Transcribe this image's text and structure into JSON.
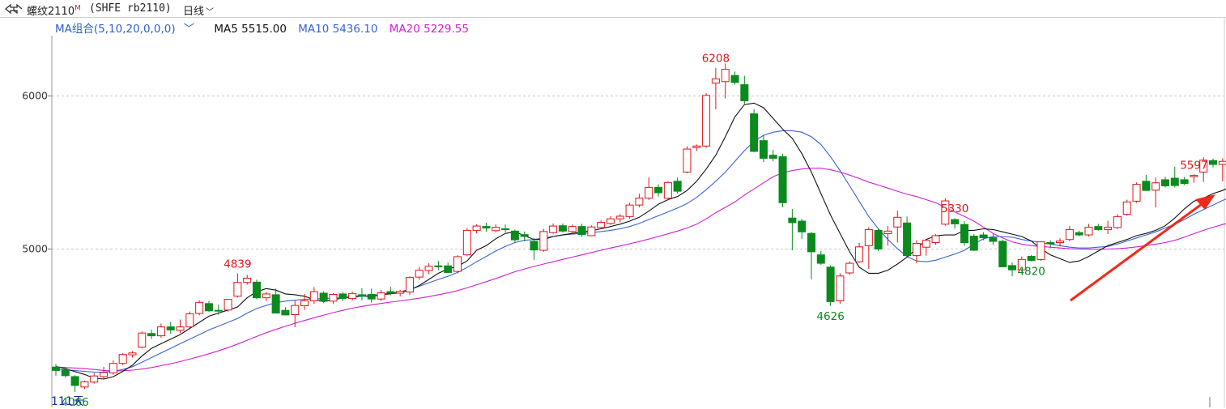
{
  "header": {
    "symbol_name": "螺纹2110",
    "symbol_flag": "M",
    "symbol_code": "(SHFE rb2110)",
    "period": "日线"
  },
  "ma_legend": {
    "combo_label": "MA组合(5,10,20,0,0,0)",
    "ma5_label": "MA5 5515.00",
    "ma10_label": "MA10 5436.10",
    "ma20_label": "MA20 5229.55"
  },
  "bottom_label": "111天",
  "colors": {
    "up": "#e0151b",
    "down": "#0b8a1e",
    "ma5": "#111111",
    "ma10": "#3a63d8",
    "ma20": "#d21ed2",
    "grid": "#c8c8c8",
    "arrow": "#ef2a1a"
  },
  "chart_data": {
    "type": "candlestick",
    "ylim": [
      3965,
      6390
    ],
    "yticks": [
      5000,
      6000
    ],
    "grid": true,
    "annotations": [
      {
        "index": 2,
        "value": 4066,
        "label": "4066",
        "position": "below",
        "color": "down"
      },
      {
        "index": 19,
        "value": 4839,
        "label": "4839",
        "position": "above",
        "color": "up"
      },
      {
        "index": 69,
        "value": 6208,
        "label": "6208",
        "position": "above",
        "color": "up"
      },
      {
        "index": 81,
        "value": 4626,
        "label": "4626",
        "position": "below",
        "color": "down"
      },
      {
        "index": 94,
        "value": 5330,
        "label": "5330",
        "position": "above",
        "color": "up"
      },
      {
        "index": 102,
        "value": 4820,
        "label": "4820",
        "position": "below",
        "color": "down"
      },
      {
        "index": 119,
        "value": 5597,
        "label": "5597",
        "position": "above",
        "color": "up"
      }
    ],
    "candles": [
      {
        "o": 4228,
        "h": 4248,
        "l": 4172,
        "c": 4206
      },
      {
        "o": 4212,
        "h": 4228,
        "l": 4160,
        "c": 4172
      },
      {
        "o": 4166,
        "h": 4175,
        "l": 4066,
        "c": 4108
      },
      {
        "o": 4098,
        "h": 4140,
        "l": 4085,
        "c": 4132
      },
      {
        "o": 4130,
        "h": 4188,
        "l": 4120,
        "c": 4170
      },
      {
        "o": 4166,
        "h": 4230,
        "l": 4150,
        "c": 4192
      },
      {
        "o": 4190,
        "h": 4272,
        "l": 4178,
        "c": 4252
      },
      {
        "o": 4252,
        "h": 4320,
        "l": 4240,
        "c": 4310
      },
      {
        "o": 4308,
        "h": 4332,
        "l": 4290,
        "c": 4320
      },
      {
        "o": 4358,
        "h": 4460,
        "l": 4350,
        "c": 4450
      },
      {
        "o": 4447,
        "h": 4472,
        "l": 4412,
        "c": 4432
      },
      {
        "o": 4432,
        "h": 4512,
        "l": 4420,
        "c": 4490
      },
      {
        "o": 4490,
        "h": 4522,
        "l": 4445,
        "c": 4470
      },
      {
        "o": 4468,
        "h": 4538,
        "l": 4450,
        "c": 4490
      },
      {
        "o": 4490,
        "h": 4590,
        "l": 4480,
        "c": 4575
      },
      {
        "o": 4578,
        "h": 4662,
        "l": 4566,
        "c": 4650
      },
      {
        "o": 4642,
        "h": 4658,
        "l": 4588,
        "c": 4595
      },
      {
        "o": 4598,
        "h": 4635,
        "l": 4570,
        "c": 4595
      },
      {
        "o": 4600,
        "h": 4662,
        "l": 4588,
        "c": 4670
      },
      {
        "o": 4690,
        "h": 4839,
        "l": 4682,
        "c": 4780
      },
      {
        "o": 4780,
        "h": 4830,
        "l": 4765,
        "c": 4808
      },
      {
        "o": 4782,
        "h": 4798,
        "l": 4670,
        "c": 4680
      },
      {
        "o": 4680,
        "h": 4718,
        "l": 4660,
        "c": 4705
      },
      {
        "o": 4700,
        "h": 4740,
        "l": 4600,
        "c": 4580
      },
      {
        "o": 4598,
        "h": 4618,
        "l": 4565,
        "c": 4568
      },
      {
        "o": 4570,
        "h": 4660,
        "l": 4488,
        "c": 4630
      },
      {
        "o": 4628,
        "h": 4705,
        "l": 4602,
        "c": 4660
      },
      {
        "o": 4660,
        "h": 4750,
        "l": 4640,
        "c": 4720
      },
      {
        "o": 4710,
        "h": 4722,
        "l": 4645,
        "c": 4658
      },
      {
        "o": 4658,
        "h": 4710,
        "l": 4640,
        "c": 4702
      },
      {
        "o": 4705,
        "h": 4718,
        "l": 4660,
        "c": 4675
      },
      {
        "o": 4675,
        "h": 4720,
        "l": 4662,
        "c": 4708
      },
      {
        "o": 4700,
        "h": 4742,
        "l": 4662,
        "c": 4690
      },
      {
        "o": 4702,
        "h": 4740,
        "l": 4648,
        "c": 4672
      },
      {
        "o": 4672,
        "h": 4732,
        "l": 4660,
        "c": 4712
      },
      {
        "o": 4720,
        "h": 4752,
        "l": 4696,
        "c": 4710
      },
      {
        "o": 4710,
        "h": 4732,
        "l": 4688,
        "c": 4722
      },
      {
        "o": 4718,
        "h": 4820,
        "l": 4700,
        "c": 4812
      },
      {
        "o": 4815,
        "h": 4882,
        "l": 4798,
        "c": 4860
      },
      {
        "o": 4858,
        "h": 4905,
        "l": 4835,
        "c": 4885
      },
      {
        "o": 4888,
        "h": 4920,
        "l": 4860,
        "c": 4882
      },
      {
        "o": 4888,
        "h": 4910,
        "l": 4842,
        "c": 4845
      },
      {
        "o": 4852,
        "h": 4958,
        "l": 4840,
        "c": 4948
      },
      {
        "o": 4960,
        "h": 5135,
        "l": 4950,
        "c": 5120
      },
      {
        "o": 5120,
        "h": 5160,
        "l": 5100,
        "c": 5148
      },
      {
        "o": 5145,
        "h": 5170,
        "l": 5110,
        "c": 5135
      },
      {
        "o": 5118,
        "h": 5158,
        "l": 5108,
        "c": 5140
      },
      {
        "o": 5130,
        "h": 5158,
        "l": 5108,
        "c": 5128
      },
      {
        "o": 5115,
        "h": 5125,
        "l": 5038,
        "c": 5058
      },
      {
        "o": 5092,
        "h": 5112,
        "l": 5048,
        "c": 5080
      },
      {
        "o": 5048,
        "h": 5070,
        "l": 4928,
        "c": 4992
      },
      {
        "o": 4990,
        "h": 5130,
        "l": 4980,
        "c": 5112
      },
      {
        "o": 5105,
        "h": 5165,
        "l": 5098,
        "c": 5148
      },
      {
        "o": 5150,
        "h": 5165,
        "l": 5105,
        "c": 5115
      },
      {
        "o": 5112,
        "h": 5158,
        "l": 5095,
        "c": 5145
      },
      {
        "o": 5145,
        "h": 5162,
        "l": 5078,
        "c": 5092
      },
      {
        "o": 5085,
        "h": 5152,
        "l": 5082,
        "c": 5142
      },
      {
        "o": 5138,
        "h": 5185,
        "l": 5128,
        "c": 5172
      },
      {
        "o": 5165,
        "h": 5212,
        "l": 5155,
        "c": 5195
      },
      {
        "o": 5195,
        "h": 5225,
        "l": 5172,
        "c": 5212
      },
      {
        "o": 5210,
        "h": 5300,
        "l": 5195,
        "c": 5285
      },
      {
        "o": 5285,
        "h": 5358,
        "l": 5270,
        "c": 5330
      },
      {
        "o": 5330,
        "h": 5465,
        "l": 5318,
        "c": 5400
      },
      {
        "o": 5400,
        "h": 5420,
        "l": 5340,
        "c": 5365
      },
      {
        "o": 5330,
        "h": 5440,
        "l": 5315,
        "c": 5432
      },
      {
        "o": 5440,
        "h": 5465,
        "l": 5360,
        "c": 5375
      },
      {
        "o": 5500,
        "h": 5668,
        "l": 5492,
        "c": 5650
      },
      {
        "o": 5660,
        "h": 5680,
        "l": 5638,
        "c": 5670
      },
      {
        "o": 5670,
        "h": 6015,
        "l": 5658,
        "c": 6000
      },
      {
        "o": 6080,
        "h": 6180,
        "l": 5910,
        "c": 6108
      },
      {
        "o": 6090,
        "h": 6208,
        "l": 5980,
        "c": 6170
      },
      {
        "o": 6130,
        "h": 6155,
        "l": 6070,
        "c": 6085
      },
      {
        "o": 6070,
        "h": 6128,
        "l": 5945,
        "c": 5965
      },
      {
        "o": 5880,
        "h": 5910,
        "l": 5630,
        "c": 5635
      },
      {
        "o": 5705,
        "h": 5740,
        "l": 5565,
        "c": 5590
      },
      {
        "o": 5610,
        "h": 5645,
        "l": 5570,
        "c": 5590
      },
      {
        "o": 5600,
        "h": 5620,
        "l": 5270,
        "c": 5300
      },
      {
        "o": 5200,
        "h": 5260,
        "l": 4990,
        "c": 5170
      },
      {
        "o": 5180,
        "h": 5195,
        "l": 5065,
        "c": 5110
      },
      {
        "o": 5100,
        "h": 5110,
        "l": 4800,
        "c": 4980
      },
      {
        "o": 4960,
        "h": 4985,
        "l": 4895,
        "c": 4905
      },
      {
        "o": 4880,
        "h": 4892,
        "l": 4626,
        "c": 4655
      },
      {
        "o": 4660,
        "h": 4840,
        "l": 4640,
        "c": 4822
      },
      {
        "o": 4842,
        "h": 4918,
        "l": 4830,
        "c": 4905
      },
      {
        "o": 4915,
        "h": 5038,
        "l": 4908,
        "c": 5012
      },
      {
        "o": 5020,
        "h": 5140,
        "l": 4868,
        "c": 5125
      },
      {
        "o": 5120,
        "h": 5130,
        "l": 4985,
        "c": 4998
      },
      {
        "o": 5098,
        "h": 5148,
        "l": 5020,
        "c": 5115
      },
      {
        "o": 5142,
        "h": 5248,
        "l": 5040,
        "c": 5205
      },
      {
        "o": 5168,
        "h": 5210,
        "l": 4968,
        "c": 4955
      },
      {
        "o": 4955,
        "h": 5055,
        "l": 4905,
        "c": 5035
      },
      {
        "o": 5010,
        "h": 5060,
        "l": 4955,
        "c": 5055
      },
      {
        "o": 5040,
        "h": 5095,
        "l": 5025,
        "c": 5085
      },
      {
        "o": 5160,
        "h": 5330,
        "l": 5150,
        "c": 5312
      },
      {
        "o": 5190,
        "h": 5200,
        "l": 5130,
        "c": 5162
      },
      {
        "o": 5158,
        "h": 5180,
        "l": 5018,
        "c": 5040
      },
      {
        "o": 5082,
        "h": 5095,
        "l": 4985,
        "c": 4990
      },
      {
        "o": 5090,
        "h": 5108,
        "l": 5055,
        "c": 5072
      },
      {
        "o": 5072,
        "h": 5098,
        "l": 5025,
        "c": 5048
      },
      {
        "o": 5048,
        "h": 5060,
        "l": 4880,
        "c": 4882
      },
      {
        "o": 4890,
        "h": 4910,
        "l": 4820,
        "c": 4862
      },
      {
        "o": 4862,
        "h": 4950,
        "l": 4852,
        "c": 4930
      },
      {
        "o": 4950,
        "h": 4958,
        "l": 4918,
        "c": 4923
      },
      {
        "o": 4930,
        "h": 5050,
        "l": 4920,
        "c": 5045
      },
      {
        "o": 5040,
        "h": 5055,
        "l": 5002,
        "c": 5032
      },
      {
        "o": 5040,
        "h": 5068,
        "l": 5015,
        "c": 5050
      },
      {
        "o": 5060,
        "h": 5148,
        "l": 5050,
        "c": 5125
      },
      {
        "o": 5105,
        "h": 5118,
        "l": 5080,
        "c": 5090
      },
      {
        "o": 5090,
        "h": 5162,
        "l": 5080,
        "c": 5140
      },
      {
        "o": 5145,
        "h": 5162,
        "l": 5118,
        "c": 5125
      },
      {
        "o": 5125,
        "h": 5182,
        "l": 5095,
        "c": 5140
      },
      {
        "o": 5138,
        "h": 5225,
        "l": 5128,
        "c": 5210
      },
      {
        "o": 5225,
        "h": 5320,
        "l": 5215,
        "c": 5305
      },
      {
        "o": 5310,
        "h": 5432,
        "l": 5300,
        "c": 5420
      },
      {
        "o": 5440,
        "h": 5482,
        "l": 5380,
        "c": 5380
      },
      {
        "o": 5382,
        "h": 5465,
        "l": 5270,
        "c": 5430
      },
      {
        "o": 5450,
        "h": 5470,
        "l": 5400,
        "c": 5410
      },
      {
        "o": 5460,
        "h": 5535,
        "l": 5400,
        "c": 5412
      },
      {
        "o": 5450,
        "h": 5468,
        "l": 5416,
        "c": 5425
      },
      {
        "o": 5470,
        "h": 5485,
        "l": 5430,
        "c": 5478
      },
      {
        "o": 5500,
        "h": 5597,
        "l": 5435,
        "c": 5578
      },
      {
        "o": 5575,
        "h": 5588,
        "l": 5530,
        "c": 5550
      },
      {
        "o": 5550,
        "h": 5590,
        "l": 5440,
        "c": 5570
      }
    ],
    "ma5": [
      4232,
      4218,
      4198,
      4180,
      4155,
      4150,
      4165,
      4200,
      4240,
      4300,
      4350,
      4380,
      4410,
      4440,
      4480,
      4520,
      4560,
      4580,
      4600,
      4620,
      4680,
      4720,
      4740,
      4730,
      4705,
      4700,
      4690,
      4668,
      4655,
      4668,
      4678,
      4690,
      4692,
      4688,
      4700,
      4706,
      4712,
      4730,
      4760,
      4800,
      4840,
      4868,
      4885,
      4920,
      4990,
      5020,
      5065,
      5100,
      5110,
      5085,
      5060,
      5060,
      5080,
      5090,
      5100,
      5110,
      5118,
      5130,
      5145,
      5160,
      5180,
      5205,
      5245,
      5290,
      5320,
      5340,
      5380,
      5440,
      5520,
      5610,
      5730,
      5860,
      5940,
      5950,
      5920,
      5850,
      5780,
      5720,
      5620,
      5500,
      5360,
      5220,
      5100,
      4980,
      4880,
      4840,
      4840,
      4860,
      4900,
      4945,
      5000,
      5060,
      5085,
      5090,
      5090,
      5120,
      5120,
      5130,
      5125,
      5110,
      5095,
      5080,
      5050,
      5000,
      4960,
      4935,
      4910,
      4920,
      4950,
      4985,
      5020,
      5040,
      5060,
      5085,
      5100,
      5120,
      5150,
      5200,
      5260,
      5310,
      5330,
      5360,
      5380,
      5410,
      5430,
      5460,
      5480,
      5510,
      5530
    ],
    "ma10": [
      4215,
      4210,
      4205,
      4200,
      4195,
      4195,
      4200,
      4212,
      4230,
      4260,
      4290,
      4320,
      4350,
      4380,
      4410,
      4440,
      4470,
      4495,
      4520,
      4545,
      4580,
      4610,
      4630,
      4648,
      4658,
      4664,
      4670,
      4672,
      4675,
      4678,
      4680,
      4684,
      4690,
      4695,
      4702,
      4710,
      4720,
      4735,
      4755,
      4778,
      4800,
      4820,
      4845,
      4878,
      4915,
      4950,
      4985,
      5015,
      5040,
      5055,
      5060,
      5070,
      5080,
      5090,
      5095,
      5100,
      5105,
      5112,
      5120,
      5130,
      5145,
      5165,
      5190,
      5215,
      5240,
      5265,
      5295,
      5335,
      5385,
      5440,
      5500,
      5570,
      5640,
      5700,
      5740,
      5760,
      5770,
      5770,
      5760,
      5730,
      5680,
      5600,
      5510,
      5410,
      5310,
      5210,
      5130,
      5060,
      5000,
      4950,
      4920,
      4915,
      4925,
      4945,
      4965,
      4990,
      5030,
      5065,
      5080,
      5080,
      5075,
      5060,
      5050,
      5040,
      5030,
      5020,
      5010,
      5005,
      5005,
      5010,
      5015,
      5030,
      5050,
      5070,
      5090,
      5110,
      5135,
      5160,
      5190,
      5225,
      5255,
      5285,
      5315,
      5340,
      5360,
      5380,
      5400,
      5420,
      5437
    ],
    "ma20": [
      4228,
      4225,
      4222,
      4218,
      4212,
      4206,
      4203,
      4204,
      4208,
      4215,
      4225,
      4237,
      4250,
      4264,
      4280,
      4297,
      4315,
      4334,
      4355,
      4378,
      4403,
      4428,
      4452,
      4474,
      4494,
      4514,
      4532,
      4550,
      4567,
      4583,
      4598,
      4612,
      4624,
      4634,
      4643,
      4652,
      4660,
      4668,
      4677,
      4688,
      4700,
      4712,
      4727,
      4745,
      4765,
      4785,
      4806,
      4828,
      4850,
      4868,
      4885,
      4900,
      4915,
      4930,
      4945,
      4960,
      4975,
      4990,
      5005,
      5018,
      5032,
      5047,
      5063,
      5080,
      5097,
      5115,
      5135,
      5160,
      5195,
      5235,
      5270,
      5305,
      5350,
      5390,
      5430,
      5470,
      5495,
      5510,
      5520,
      5525,
      5525,
      5515,
      5500,
      5480,
      5458,
      5435,
      5415,
      5395,
      5375,
      5355,
      5340,
      5320,
      5300,
      5270,
      5240,
      5210,
      5180,
      5140,
      5100,
      5070,
      5045,
      5030,
      5020,
      5015,
      5010,
      5005,
      5000,
      4998,
      4997,
      4997,
      4998,
      5000,
      5005,
      5012,
      5020,
      5030,
      5040,
      5055,
      5075,
      5098,
      5120,
      5140,
      5158,
      5173,
      5187,
      5198,
      5207,
      5218,
      5230
    ]
  }
}
